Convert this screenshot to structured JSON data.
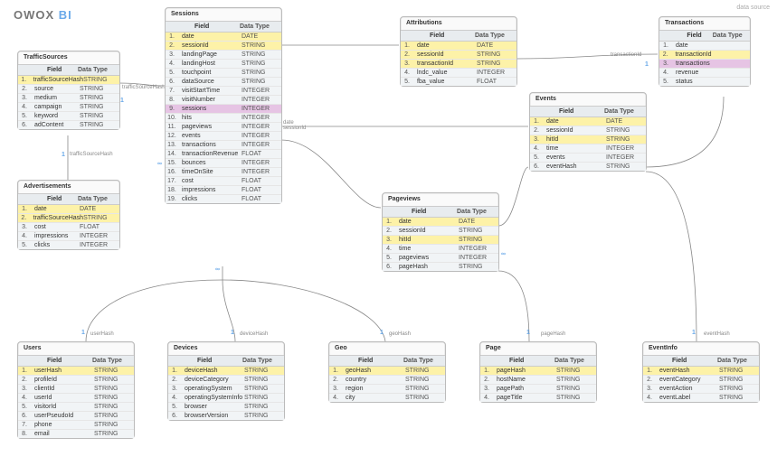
{
  "brand": {
    "owox": "OWOX",
    "bi": "BI"
  },
  "top_right": "data source",
  "headers": {
    "field": "Field",
    "datatype": "Data Type"
  },
  "entities": {
    "TrafficSources": {
      "title": "TrafficSources",
      "rows": [
        {
          "n": "1.",
          "f": "trafficSourceHash",
          "t": "STRING",
          "cls": "hl"
        },
        {
          "n": "2.",
          "f": "source",
          "t": "STRING",
          "cls": "norm"
        },
        {
          "n": "3.",
          "f": "medium",
          "t": "STRING",
          "cls": "norm"
        },
        {
          "n": "4.",
          "f": "campaign",
          "t": "STRING",
          "cls": "norm"
        },
        {
          "n": "5.",
          "f": "keyword",
          "t": "STRING",
          "cls": "norm"
        },
        {
          "n": "6.",
          "f": "adContent",
          "t": "STRING",
          "cls": "norm"
        }
      ]
    },
    "Advertisements": {
      "title": "Advertisements",
      "rows": [
        {
          "n": "1.",
          "f": "date",
          "t": "DATE",
          "cls": "hl"
        },
        {
          "n": "2.",
          "f": "trafficSourceHash",
          "t": "STRING",
          "cls": "hl"
        },
        {
          "n": "3.",
          "f": "cost",
          "t": "FLOAT",
          "cls": "norm"
        },
        {
          "n": "4.",
          "f": "impressions",
          "t": "INTEGER",
          "cls": "norm"
        },
        {
          "n": "5.",
          "f": "clicks",
          "t": "INTEGER",
          "cls": "norm"
        }
      ]
    },
    "Sessions": {
      "title": "Sessions",
      "rows": [
        {
          "n": "1.",
          "f": "date",
          "t": "DATE",
          "cls": "hl"
        },
        {
          "n": "2.",
          "f": "sessionId",
          "t": "STRING",
          "cls": "hl"
        },
        {
          "n": "3.",
          "f": "landingPage",
          "t": "STRING",
          "cls": "norm"
        },
        {
          "n": "4.",
          "f": "landingHost",
          "t": "STRING",
          "cls": "norm"
        },
        {
          "n": "5.",
          "f": "touchpoint",
          "t": "STRING",
          "cls": "norm"
        },
        {
          "n": "6.",
          "f": "dataSource",
          "t": "STRING",
          "cls": "norm"
        },
        {
          "n": "7.",
          "f": "visitStartTime",
          "t": "INTEGER",
          "cls": "norm"
        },
        {
          "n": "8.",
          "f": "visitNumber",
          "t": "INTEGER",
          "cls": "norm"
        },
        {
          "n": "9.",
          "f": "sessions",
          "t": "INTEGER",
          "cls": "sel"
        },
        {
          "n": "10.",
          "f": "hits",
          "t": "INTEGER",
          "cls": "norm"
        },
        {
          "n": "11.",
          "f": "pageviews",
          "t": "INTEGER",
          "cls": "norm"
        },
        {
          "n": "12.",
          "f": "events",
          "t": "INTEGER",
          "cls": "norm"
        },
        {
          "n": "13.",
          "f": "transactions",
          "t": "INTEGER",
          "cls": "norm"
        },
        {
          "n": "14.",
          "f": "transactionRevenue",
          "t": "FLOAT",
          "cls": "norm"
        },
        {
          "n": "15.",
          "f": "bounces",
          "t": "INTEGER",
          "cls": "norm"
        },
        {
          "n": "16.",
          "f": "timeOnSite",
          "t": "INTEGER",
          "cls": "norm"
        },
        {
          "n": "17.",
          "f": "cost",
          "t": "FLOAT",
          "cls": "norm"
        },
        {
          "n": "18.",
          "f": "impressions",
          "t": "FLOAT",
          "cls": "norm"
        },
        {
          "n": "19.",
          "f": "clicks",
          "t": "FLOAT",
          "cls": "norm"
        }
      ]
    },
    "Attributions": {
      "title": "Attributions",
      "rows": [
        {
          "n": "1.",
          "f": "date",
          "t": "DATE",
          "cls": "hl"
        },
        {
          "n": "2.",
          "f": "sessionId",
          "t": "STRING",
          "cls": "hl"
        },
        {
          "n": "3.",
          "f": "transactionId",
          "t": "STRING",
          "cls": "hl"
        },
        {
          "n": "4.",
          "f": "lndc_value",
          "t": "INTEGER",
          "cls": "norm"
        },
        {
          "n": "5.",
          "f": "fba_value",
          "t": "FLOAT",
          "cls": "norm"
        }
      ]
    },
    "Transactions": {
      "title": "Transactions",
      "rows": [
        {
          "n": "1.",
          "f": "date",
          "t": "",
          "cls": "norm"
        },
        {
          "n": "2.",
          "f": "transactionId",
          "t": "",
          "cls": "hl"
        },
        {
          "n": "3.",
          "f": "transactions",
          "t": "",
          "cls": "sel"
        },
        {
          "n": "4.",
          "f": "revenue",
          "t": "",
          "cls": "norm"
        },
        {
          "n": "5.",
          "f": "status",
          "t": "",
          "cls": "norm"
        }
      ]
    },
    "Events": {
      "title": "Events",
      "rows": [
        {
          "n": "1.",
          "f": "date",
          "t": "DATE",
          "cls": "hl"
        },
        {
          "n": "2.",
          "f": "sessionId",
          "t": "STRING",
          "cls": "norm"
        },
        {
          "n": "3.",
          "f": "hitId",
          "t": "STRING",
          "cls": "hl"
        },
        {
          "n": "4.",
          "f": "time",
          "t": "INTEGER",
          "cls": "norm"
        },
        {
          "n": "5.",
          "f": "events",
          "t": "INTEGER",
          "cls": "norm"
        },
        {
          "n": "6.",
          "f": "eventHash",
          "t": "STRING",
          "cls": "norm"
        }
      ]
    },
    "Pageviews": {
      "title": "Pageviews",
      "rows": [
        {
          "n": "1.",
          "f": "date",
          "t": "DATE",
          "cls": "hl"
        },
        {
          "n": "2.",
          "f": "sessionId",
          "t": "STRING",
          "cls": "norm"
        },
        {
          "n": "3.",
          "f": "hitId",
          "t": "STRING",
          "cls": "hl"
        },
        {
          "n": "4.",
          "f": "time",
          "t": "INTEGER",
          "cls": "norm"
        },
        {
          "n": "5.",
          "f": "pageviews",
          "t": "INTEGER",
          "cls": "norm"
        },
        {
          "n": "6.",
          "f": "pageHash",
          "t": "STRING",
          "cls": "norm"
        }
      ]
    },
    "Users": {
      "title": "Users",
      "rows": [
        {
          "n": "1.",
          "f": "userHash",
          "t": "STRING",
          "cls": "hl"
        },
        {
          "n": "2.",
          "f": "profileId",
          "t": "STRING",
          "cls": "norm"
        },
        {
          "n": "3.",
          "f": "clientId",
          "t": "STRING",
          "cls": "norm"
        },
        {
          "n": "4.",
          "f": "userId",
          "t": "STRING",
          "cls": "norm"
        },
        {
          "n": "5.",
          "f": "visitorId",
          "t": "STRING",
          "cls": "norm"
        },
        {
          "n": "6.",
          "f": "userPseudoId",
          "t": "STRING",
          "cls": "norm"
        },
        {
          "n": "7.",
          "f": "phone",
          "t": "STRING",
          "cls": "norm"
        },
        {
          "n": "8.",
          "f": "email",
          "t": "STRING",
          "cls": "norm"
        }
      ]
    },
    "Devices": {
      "title": "Devices",
      "rows": [
        {
          "n": "1.",
          "f": "deviceHash",
          "t": "STRING",
          "cls": "hl"
        },
        {
          "n": "2.",
          "f": "deviceCategory",
          "t": "STRING",
          "cls": "norm"
        },
        {
          "n": "3.",
          "f": "operatingSystem",
          "t": "STRING",
          "cls": "norm"
        },
        {
          "n": "4.",
          "f": "operatingSystemInfo",
          "t": "STRING",
          "cls": "norm"
        },
        {
          "n": "5.",
          "f": "browser",
          "t": "STRING",
          "cls": "norm"
        },
        {
          "n": "6.",
          "f": "browserVersion",
          "t": "STRING",
          "cls": "norm"
        }
      ]
    },
    "Geo": {
      "title": "Geo",
      "rows": [
        {
          "n": "1.",
          "f": "geoHash",
          "t": "STRING",
          "cls": "hl"
        },
        {
          "n": "2.",
          "f": "country",
          "t": "STRING",
          "cls": "norm"
        },
        {
          "n": "3.",
          "f": "region",
          "t": "STRING",
          "cls": "norm"
        },
        {
          "n": "4.",
          "f": "city",
          "t": "STRING",
          "cls": "norm"
        }
      ]
    },
    "Page": {
      "title": "Page",
      "rows": [
        {
          "n": "1.",
          "f": "pageHash",
          "t": "STRING",
          "cls": "hl"
        },
        {
          "n": "2.",
          "f": "hostName",
          "t": "STRING",
          "cls": "norm"
        },
        {
          "n": "3.",
          "f": "pagePath",
          "t": "STRING",
          "cls": "norm"
        },
        {
          "n": "4.",
          "f": "pageTitle",
          "t": "STRING",
          "cls": "norm"
        }
      ]
    },
    "EventInfo": {
      "title": "EventInfo",
      "rows": [
        {
          "n": "1.",
          "f": "eventHash",
          "t": "STRING",
          "cls": "hl"
        },
        {
          "n": "2.",
          "f": "eventCategory",
          "t": "STRING",
          "cls": "norm"
        },
        {
          "n": "3.",
          "f": "eventAction",
          "t": "STRING",
          "cls": "norm"
        },
        {
          "n": "4.",
          "f": "eventLabel",
          "t": "STRING",
          "cls": "norm"
        }
      ]
    }
  },
  "labels": {
    "trafficSourceHash_top": "trafficSourceHash",
    "trafficSourceHash_mid": "trafficSourceHash",
    "date_sessionId": "date\nsessionId",
    "transactionId": "transactionId",
    "userHash": "userHash",
    "deviceHash": "deviceHash",
    "geoHash": "geoHash",
    "pageHash": "pageHash",
    "eventHash": "eventHash"
  },
  "cardinality": {
    "one": "1",
    "many": "∞"
  }
}
